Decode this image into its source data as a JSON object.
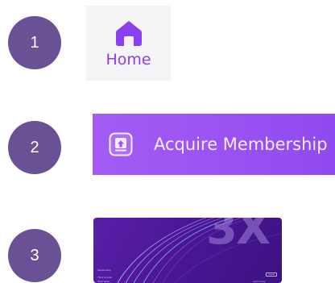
{
  "steps": {
    "step1": "1",
    "step2": "2",
    "step3": "3"
  },
  "home_tab": {
    "label": "Home",
    "icon": "home-icon",
    "accent_color": "#8a3ff0",
    "background": "#f4f3f6"
  },
  "membership_banner": {
    "label": "Acquire Membership",
    "icon": "upgrade-badge-icon",
    "background": "#9a52f2"
  },
  "promo_card": {
    "headline": "3X",
    "line1": "Membership",
    "line2": "Think smarter",
    "line3": "Work faster",
    "button_label": "Upgrade",
    "footer_text": "Learn more"
  },
  "badge_color": "#6a5196"
}
